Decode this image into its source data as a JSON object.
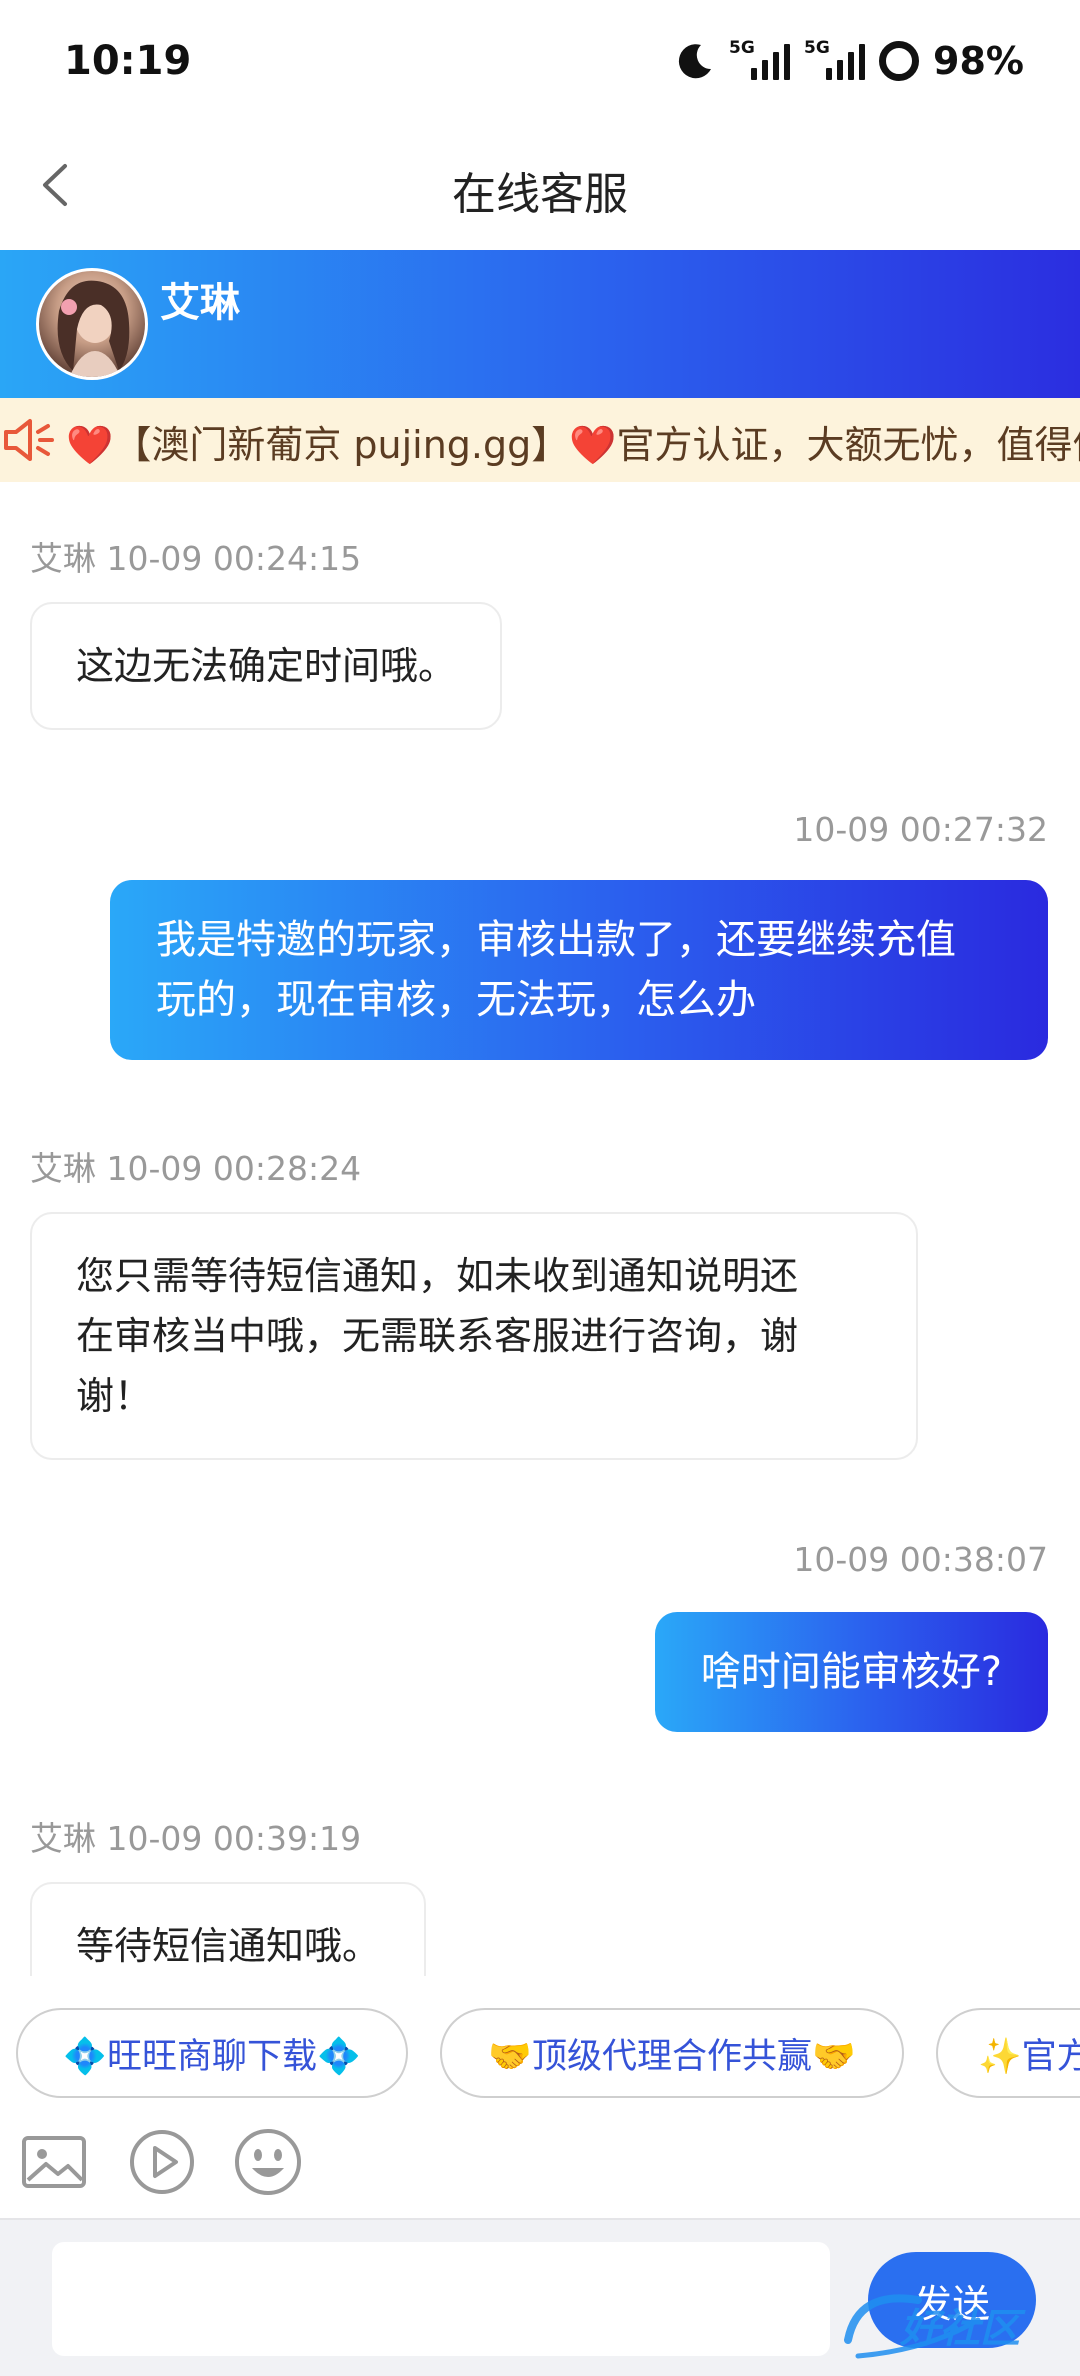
{
  "status_bar": {
    "time": "10:19",
    "sim1_tag": "5G",
    "sim2_tag": "5G",
    "battery": "98%"
  },
  "header": {
    "title": "在线客服"
  },
  "agent": {
    "name": "艾琳"
  },
  "notice": {
    "text": "❤️【澳门新葡京 pujing.gg】❤️官方认证，大额无忧，值得信赖"
  },
  "messages": [
    {
      "meta": "艾琳 10-09 00:24:15",
      "text": "这边无法确定时间哦。",
      "side": "agent"
    },
    {
      "meta": "10-09 00:27:32",
      "line1": "我是特邀的玩家，审核出款了，还要继续充值",
      "line2": "玩的，现在审核，无法玩，怎么办",
      "side": "user"
    },
    {
      "meta": "艾琳 10-09 00:28:24",
      "line1": "您只需等待短信通知，如未收到通知说明还",
      "line2": "在审核当中哦，无需联系客服进行咨询，谢",
      "line3": "谢！",
      "side": "agent"
    },
    {
      "meta": "10-09 00:38:07",
      "text": "啥时间能审核好?",
      "side": "user"
    },
    {
      "meta": "艾琳 10-09 00:39:19",
      "text": "等待短信通知哦。",
      "side": "agent"
    }
  ],
  "quick_replies": [
    {
      "label": "💠旺旺商聊下载💠"
    },
    {
      "label": "🤝顶级代理合作共赢🤝"
    },
    {
      "label": "✨官方"
    }
  ],
  "tools": {
    "image": "image-icon",
    "video": "video-play-icon",
    "emoji": "emoji-icon"
  },
  "input": {
    "value": "",
    "send_label": "发送"
  },
  "watermark": {
    "text": "好社区"
  },
  "colors": {
    "gradient_start": "#2aa6f6",
    "gradient_end": "#2b2ee0",
    "notice_bg": "#fdf3dc",
    "chip_text": "#3553d8"
  }
}
